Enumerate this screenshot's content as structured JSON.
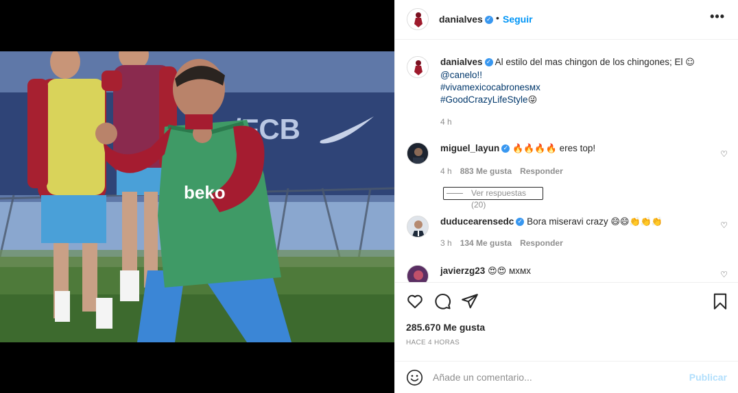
{
  "post": {
    "author": "danialves",
    "follow_label": "Seguir",
    "dot": "•",
    "more_label": "•••"
  },
  "caption": {
    "username": "danialves",
    "text": "Al estilo del mas chingon de los chingones; El",
    "mention": "@canelo!!",
    "hashtag1": "#vivamexicocabronesмх",
    "hashtag2": "#GoodCrazyLifeStyle",
    "time": "4 h"
  },
  "comments": [
    {
      "username": "miguel_layun",
      "text": "eres top!",
      "emojis": "🔥🔥🔥🔥",
      "time": "4 h",
      "likes": "883 Me gusta",
      "reply": "Responder",
      "view_replies": "Ver respuestas (20)"
    },
    {
      "username": "duducearensedc",
      "text": "Bora miseravi crazy",
      "emojis": "😄😄👏👏👏",
      "time": "3 h",
      "likes": "134 Me gusta",
      "reply": "Responder"
    },
    {
      "username": "javierzg23",
      "text": "мхмх",
      "emojis": "😍😍"
    }
  ],
  "stats": {
    "likes": "285.670 Me gusta",
    "time_ago": "HACE 4 HORAS"
  },
  "composer": {
    "placeholder": "Añade un comentario...",
    "publish": "Publicar"
  },
  "photo_text": {
    "wall_logo": "/FCB",
    "shirt_logo": "beko"
  },
  "icons": {
    "like": "heart-icon",
    "comment": "comment-icon",
    "share": "paper-plane-icon",
    "save": "bookmark-icon",
    "emoji": "smiley-icon",
    "verified": "verified-badge-icon"
  },
  "colors": {
    "accent": "#0095f6",
    "publish_disabled": "#b2dffc",
    "verified": "#3897f0",
    "muted": "#8e8e8e",
    "text": "#262626"
  }
}
